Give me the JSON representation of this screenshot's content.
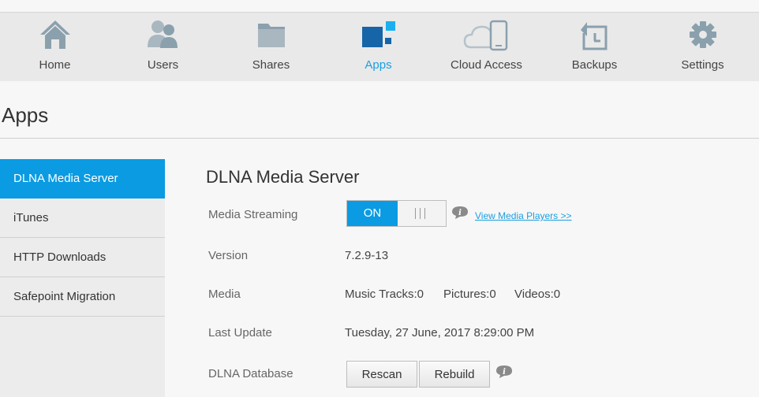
{
  "nav": {
    "items": [
      {
        "label": "Home",
        "icon": "home-icon"
      },
      {
        "label": "Users",
        "icon": "users-icon"
      },
      {
        "label": "Shares",
        "icon": "folder-icon"
      },
      {
        "label": "Apps",
        "icon": "apps-icon",
        "active": true
      },
      {
        "label": "Cloud Access",
        "icon": "cloud-device-icon"
      },
      {
        "label": "Backups",
        "icon": "backup-icon"
      },
      {
        "label": "Settings",
        "icon": "gear-icon"
      }
    ],
    "active_color": "#1a9fe0",
    "icon_color": "#8ba0ad"
  },
  "page": {
    "title": "Apps"
  },
  "sidebar": {
    "items": [
      {
        "label": "DLNA Media Server",
        "active": true
      },
      {
        "label": "iTunes"
      },
      {
        "label": "HTTP Downloads"
      },
      {
        "label": "Safepoint Migration"
      }
    ],
    "active_color": "#0a9be2"
  },
  "dlna": {
    "title": "DLNA Media Server",
    "streaming_label": "Media Streaming",
    "streaming_state": "ON",
    "view_players_link": "View Media Players >>",
    "version_label": "Version",
    "version_value": "7.2.9-13",
    "media_label": "Media",
    "music_tracks": "Music Tracks:0",
    "pictures": "Pictures:0",
    "videos": "Videos:0",
    "last_update_label": "Last Update",
    "last_update_value": "Tuesday, 27 June, 2017 8:29:00 PM",
    "database_label": "DLNA Database",
    "rescan_label": "Rescan",
    "rebuild_label": "Rebuild"
  }
}
